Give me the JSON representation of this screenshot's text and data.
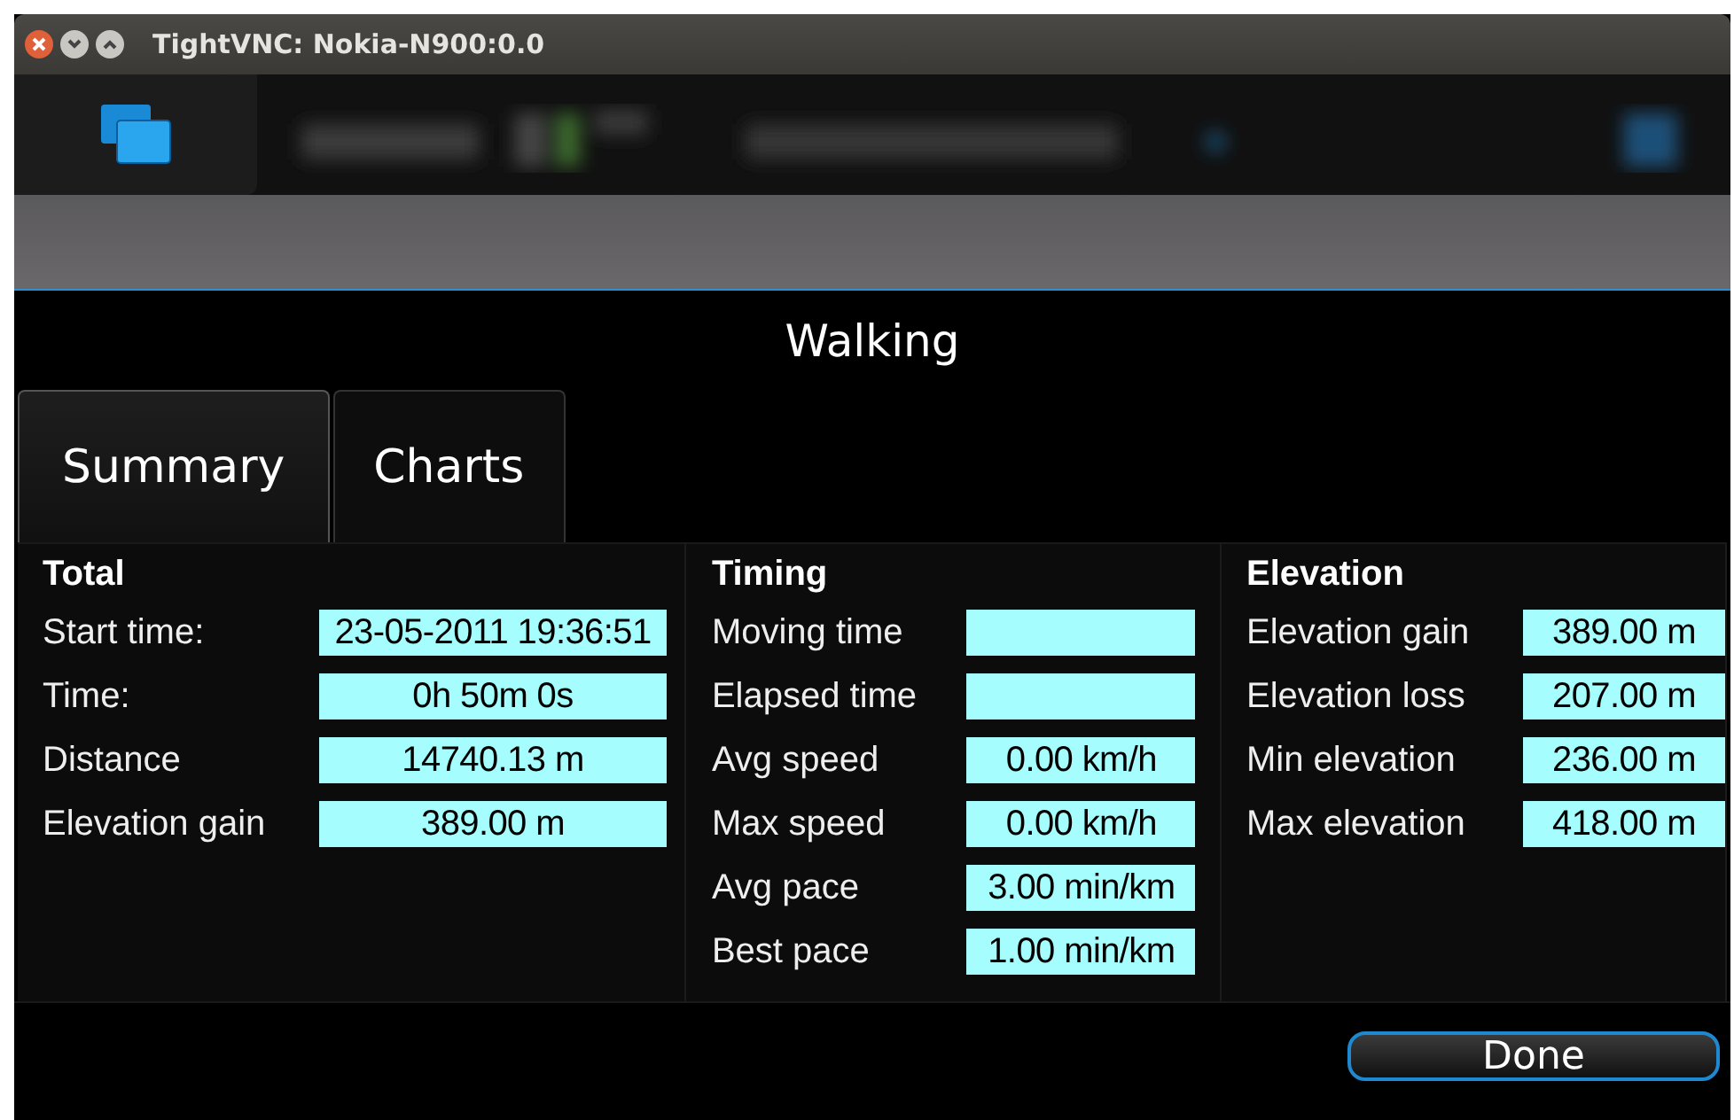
{
  "window": {
    "title": "TightVNC: Nokia-N900:0.0"
  },
  "screen_title": "Walking",
  "tabs": [
    {
      "label": "Summary",
      "selected": true
    },
    {
      "label": "Charts",
      "selected": false
    }
  ],
  "sections": [
    {
      "title": "Total",
      "fields": [
        {
          "label": "Start time:",
          "value": "23-05-2011 19:36:51"
        },
        {
          "label": "Time:",
          "value": "0h 50m 0s"
        },
        {
          "label": "Distance",
          "value": "14740.13 m"
        },
        {
          "label": "Elevation gain",
          "value": "389.00 m"
        }
      ]
    },
    {
      "title": "Timing",
      "fields": [
        {
          "label": "Moving time"
        },
        {
          "label": "Elapsed time"
        },
        {
          "label": "Avg speed",
          "value": "0.00 km/h"
        },
        {
          "label": "Max speed",
          "value": "0.00 km/h"
        },
        {
          "label": "Avg pace",
          "value": "3.00 min/km"
        },
        {
          "label": "Best pace",
          "value": "1.00 min/km"
        }
      ]
    },
    {
      "title": "Elevation",
      "fields": [
        {
          "label": "Elevation gain",
          "value": "389.00 m"
        },
        {
          "label": "Elevation loss",
          "value": "207.00 m"
        },
        {
          "label": "Min elevation",
          "value": "236.00 m"
        },
        {
          "label": "Max elevation",
          "value": "418.00 m"
        }
      ]
    }
  ],
  "buttons": [
    "Done"
  ]
}
